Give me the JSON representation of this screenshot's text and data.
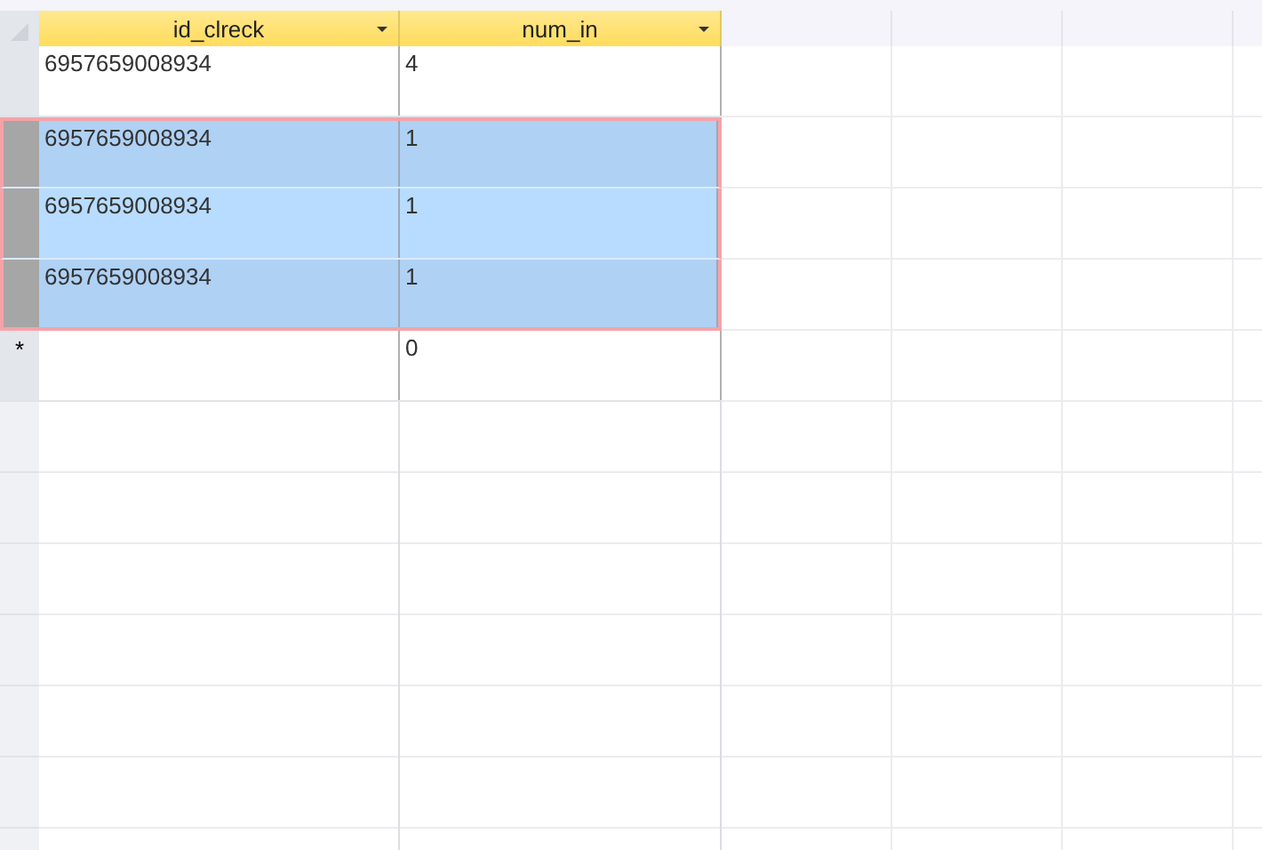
{
  "columns": [
    {
      "label": "id_clreck"
    },
    {
      "label": "num_in"
    }
  ],
  "rows": [
    {
      "cells": [
        "6957659008934",
        "4"
      ],
      "selected": false,
      "current": false
    },
    {
      "cells": [
        "6957659008934",
        "1"
      ],
      "selected": true,
      "current": false
    },
    {
      "cells": [
        "6957659008934",
        "1"
      ],
      "selected": true,
      "current": true
    },
    {
      "cells": [
        "6957659008934",
        "1"
      ],
      "selected": true,
      "current": false
    }
  ],
  "new_row": {
    "marker": "*",
    "num_in": "0"
  }
}
